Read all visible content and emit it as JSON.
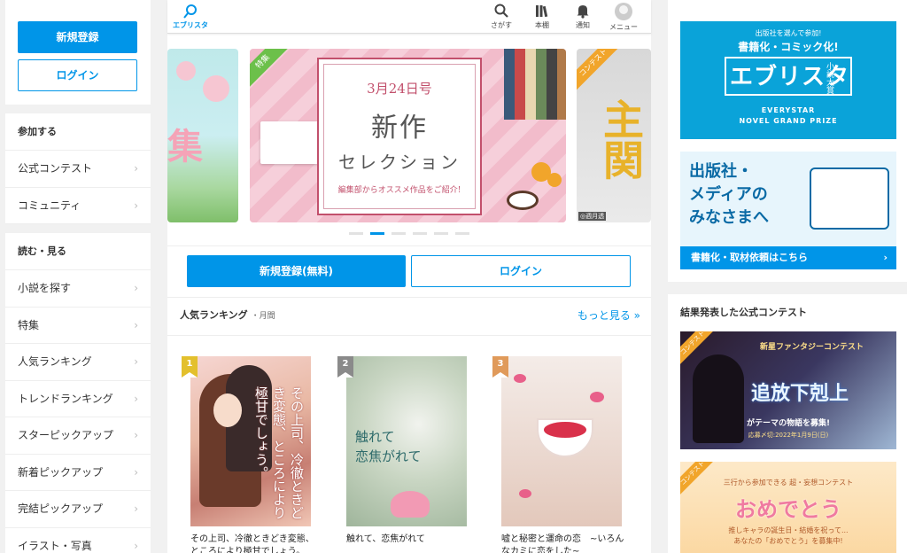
{
  "left": {
    "signup_label": "新規登録",
    "login_label": "ログイン",
    "sections": [
      {
        "heading": "参加する",
        "items": [
          "公式コンテスト",
          "コミュニティ"
        ]
      },
      {
        "heading": "読む・見る",
        "items": [
          "小説を探す",
          "特集",
          "人気ランキング",
          "トレンドランキング",
          "スターピックアップ",
          "新着ピックアップ",
          "完結ピックアップ",
          "イラスト・写真"
        ]
      }
    ],
    "chevron": "›"
  },
  "header": {
    "logo_text": "エブリスタ",
    "nav": [
      {
        "label": "さがす",
        "icon": "search-icon"
      },
      {
        "label": "本棚",
        "icon": "bookshelf-icon"
      },
      {
        "label": "通知",
        "icon": "bell-icon"
      },
      {
        "label": "メニュー",
        "icon": "avatar-icon"
      }
    ]
  },
  "carousel": {
    "left_slide_text": "集",
    "main": {
      "tag": "特集",
      "date": "3月24日号",
      "title1": "新作",
      "title2": "セレクション",
      "subtitle": "編集部からオススメ作品をご紹介!"
    },
    "right": {
      "tag": "コンテスト",
      "text": "主関",
      "badge": "◎週月透"
    },
    "dots_count": 6,
    "active_dot": 1
  },
  "center_auth": {
    "signup_label": "新規登録(無料)",
    "login_label": "ログイン"
  },
  "ranking": {
    "title": "人気ランキング",
    "period": "・月間",
    "more": "もっと見る »",
    "items": [
      {
        "rank": "1",
        "rank_color": "#e3c02d",
        "caption": "その上司、冷徹ときどき変態、ところにより極甘でしょう。",
        "cover_text": "その上司、冷徹ときどき変態、ところにより極甘でしょう。"
      },
      {
        "rank": "2",
        "rank_color": "#8a8a8a",
        "caption": "触れて、恋焦がれて",
        "cover_text": "触れて\n恋焦がれて"
      },
      {
        "rank": "3",
        "rank_color": "#e09a5a",
        "caption": "嘘と秘密と運命の恋　~いろんなカミに恋をした~",
        "cover_text": ""
      }
    ]
  },
  "right": {
    "banner1": {
      "line1": "出版社を選んで参加!",
      "line2": "書籍化・コミック化!",
      "logo": "エブリスタ",
      "small": "小説大賞",
      "en1": "EVERYSTAR",
      "en2": "NOVEL GRAND PRIZE"
    },
    "banner2": {
      "text": "出版社・\nメディアの\nみなさまへ",
      "bar": "書籍化・取材依頼はこちら",
      "chevron": "›"
    },
    "results_title": "結果発表した公式コンテスト",
    "contest1": {
      "tag": "コンテスト",
      "sub": "新星ファンタジーコンテスト",
      "title": "追放下剋上",
      "line": "がテーマの物語を募集!",
      "date": "応募〆切:2022年1月9日(日)"
    },
    "contest2": {
      "tag": "コンテスト",
      "sub": "三行から参加できる 超・妄想コンテスト",
      "title": "おめでとう",
      "l1": "推しキャラの誕生日・結婚を祝って...",
      "l2": "あなたの「おめでとう」を募集中!"
    }
  },
  "colors": {
    "accent": "#0095e8",
    "sidebar_bg": "#ffffff",
    "page_bg": "#f1f1f1"
  }
}
